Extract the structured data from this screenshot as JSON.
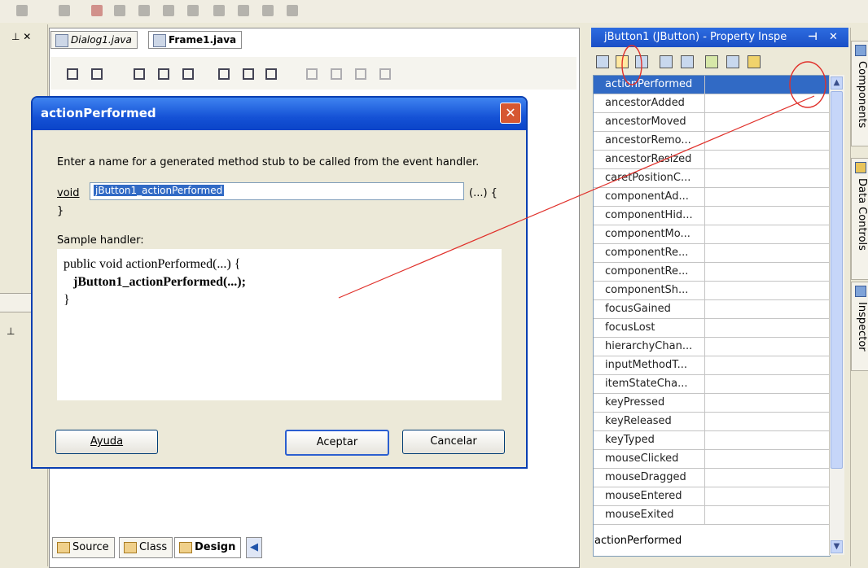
{
  "editor": {
    "tabs": [
      {
        "label": "Dialog1.java"
      },
      {
        "label": "Frame1.java"
      }
    ],
    "bottom_tabs": [
      {
        "label": "Source"
      },
      {
        "label": "Class"
      },
      {
        "label": "Design"
      }
    ]
  },
  "dialog": {
    "title": "actionPerformed",
    "description": "Enter a name for a generated method stub to be called from the event handler.",
    "void_label": "void",
    "method_name": "jButton1_actionPerformed",
    "paren_label": "(...) {",
    "close_brace": "}",
    "sample_label": "Sample handler:",
    "sample_lines": [
      "public void actionPerformed(...) {",
      "jButton1_actionPerformed(...);",
      "}"
    ],
    "buttons": {
      "help": "Ayuda",
      "ok": "Aceptar",
      "cancel": "Cancelar"
    }
  },
  "inspector": {
    "title": "jButton1 (JButton) - Property Inspe",
    "events": [
      "actionPerformed",
      "ancestorAdded",
      "ancestorMoved",
      "ancestorRemo...",
      "ancestorResized",
      "caretPositionC...",
      "componentAd...",
      "componentHid...",
      "componentMo...",
      "componentRe...",
      "componentRe...",
      "componentSh...",
      "focusGained",
      "focusLost",
      "hierarchyChan...",
      "inputMethodT...",
      "itemStateCha...",
      "keyPressed",
      "keyReleased",
      "keyTyped",
      "mouseClicked",
      "mouseDragged",
      "mouseEntered",
      "mouseExited"
    ],
    "selected_index": 0,
    "status": "actionPerformed"
  },
  "side_tabs": [
    {
      "label": "Components"
    },
    {
      "label": "Data Controls"
    },
    {
      "label": "Inspector"
    }
  ],
  "colors": {
    "selection": "#316ac5",
    "title_bar": "#1552d6",
    "annotation": "#e0302a"
  }
}
